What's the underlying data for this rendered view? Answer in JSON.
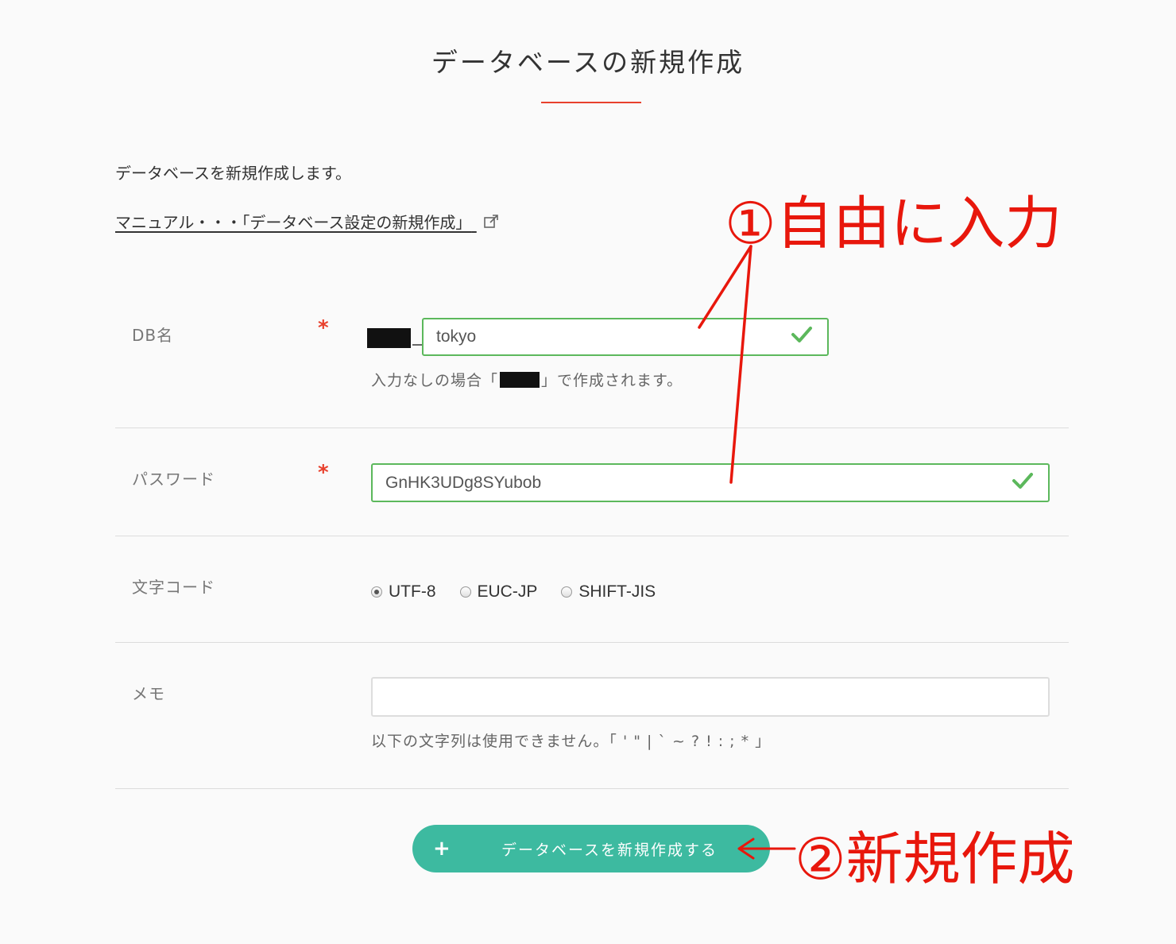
{
  "page": {
    "title": "データベースの新規作成"
  },
  "intro": {
    "text": "データベースを新規作成します。"
  },
  "manual": {
    "link_text": "マニュアル・・・「データベース設定の新規作成」"
  },
  "form": {
    "db_name": {
      "label": "DB名",
      "required_mark": "*",
      "value": "tokyo",
      "hint_before": "入力なしの場合「",
      "hint_after": "」で作成されます。"
    },
    "password": {
      "label": "パスワード",
      "required_mark": "*",
      "value": "GnHK3UDg8SYubob"
    },
    "charset": {
      "label": "文字コード",
      "options": [
        "UTF-8",
        "EUC-JP",
        "SHIFT-JIS"
      ],
      "selected": "UTF-8"
    },
    "memo": {
      "label": "メモ",
      "value": "",
      "hint": "以下の文字列は使用できません。「 ' \" | ` ~ ? ! : ; * 」"
    }
  },
  "submit": {
    "plus": "+",
    "label": "データベースを新規作成する"
  },
  "annotations": {
    "step1": "①自由に入力",
    "step2": "②新規作成",
    "color": "#e8170c"
  },
  "colors": {
    "accent": "#3dbaa0",
    "valid": "#5cb85c",
    "required": "#e8402c"
  }
}
